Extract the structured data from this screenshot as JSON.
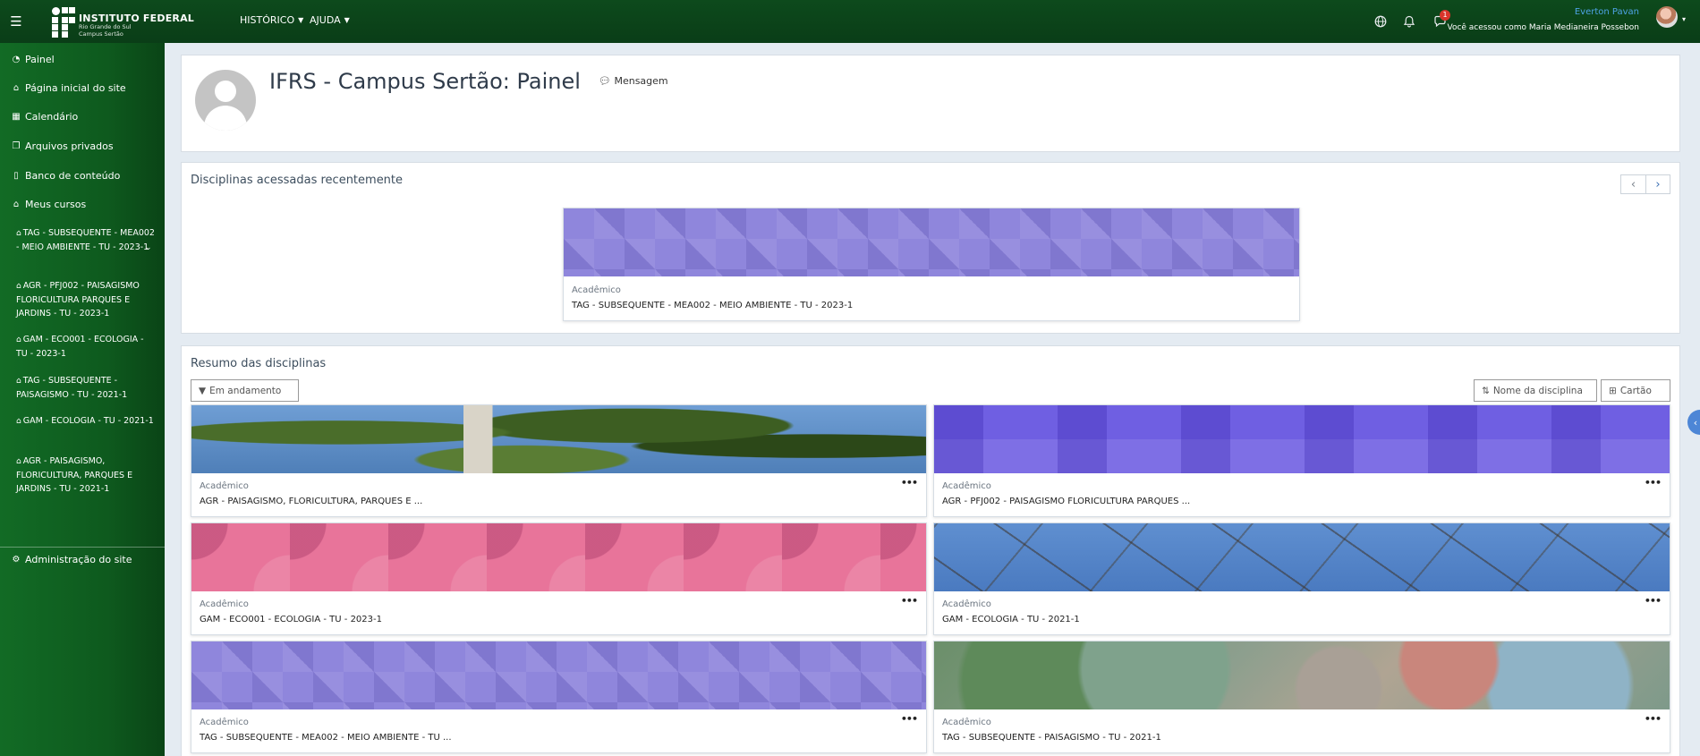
{
  "brand": {
    "title": "INSTITUTO FEDERAL",
    "subtitle_line1": "Rio Grande do Sul",
    "subtitle_line2": "Campus Sertão"
  },
  "topnav": {
    "menu_historico": "HISTÓRICO",
    "menu_ajuda": "AJUDA",
    "messages_badge": "1",
    "user_name": "Everton Pavan",
    "logged_in_as": "Você acessou como Maria Medianeira Possebon"
  },
  "sidebar": {
    "items": [
      {
        "label": "Painel",
        "icon": "dashboard-icon"
      },
      {
        "label": "Página inicial do site",
        "icon": "home-icon"
      },
      {
        "label": "Calendário",
        "icon": "calendar-icon"
      },
      {
        "label": "Arquivos privados",
        "icon": "files-icon"
      },
      {
        "label": "Banco de conteúdo",
        "icon": "clipboard-icon"
      },
      {
        "label": "Meus cursos",
        "icon": "graduation-cap-icon"
      }
    ],
    "courses": [
      "TAG - SUBSEQUENTE - MEA002 - MEIO AMBIENTE - TU - 2023-1",
      "AGR - PFJ002 - PAISAGISMO FLORICULTURA PARQUES E JARDINS - TU - 2023-1",
      "GAM - ECO001 - ECOLOGIA - TU - 2023-1",
      "TAG - SUBSEQUENTE - PAISAGISMO - TU - 2021-1",
      "GAM - ECOLOGIA - TU - 2021-1",
      "AGR - PAISAGISMO, FLORICULTURA, PARQUES E JARDINS - TU - 2021-1"
    ],
    "admin": "Administração do site"
  },
  "header": {
    "title": "IFRS - Campus Sertão: Painel",
    "message_link": "Mensagem"
  },
  "recent": {
    "title": "Disciplinas acessadas recentemente",
    "course": {
      "category": "Acadêmico",
      "name": "TAG - SUBSEQUENTE - MEA002 - MEIO AMBIENTE - TU - 2023-1"
    }
  },
  "summary": {
    "title": "Resumo das disciplinas",
    "filter": "Em andamento",
    "sort": "Nome da disciplina",
    "view": "Cartão",
    "courses": [
      {
        "category": "Acadêmico",
        "name": "AGR - PAISAGISMO, FLORICULTURA, PARQUES E ..."
      },
      {
        "category": "Acadêmico",
        "name": "AGR - PFJ002 - PAISAGISMO FLORICULTURA PARQUES ..."
      },
      {
        "category": "Acadêmico",
        "name": "GAM - ECO001 - ECOLOGIA - TU - 2023-1"
      },
      {
        "category": "Acadêmico",
        "name": "GAM - ECOLOGIA - TU - 2021-1"
      },
      {
        "category": "Acadêmico",
        "name": "TAG - SUBSEQUENTE - MEA002 - MEIO AMBIENTE - TU ..."
      },
      {
        "category": "Acadêmico",
        "name": "TAG - SUBSEQUENTE - PAISAGISMO - TU - 2021-1"
      }
    ]
  },
  "colors": {
    "navbar": "#0d4a1c",
    "sidebar": "#126b25",
    "link_blue": "#4ea3e6",
    "badge_red": "#d9342b"
  }
}
